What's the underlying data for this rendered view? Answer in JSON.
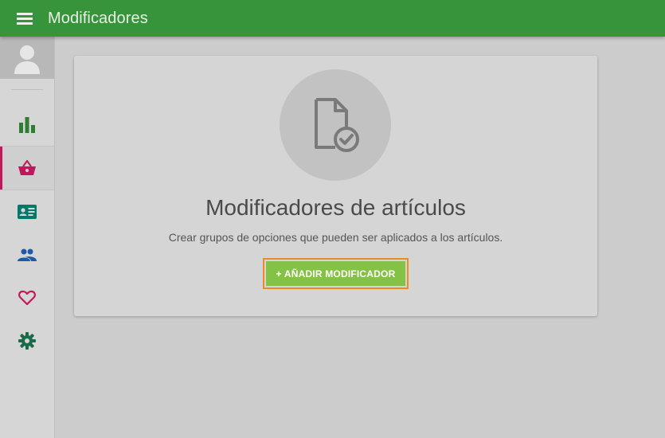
{
  "header": {
    "title": "Modificadores"
  },
  "sidebar": {
    "items": [
      {
        "name": "reports",
        "icon": "bar-chart-icon",
        "color": "#2e7d32",
        "active": false
      },
      {
        "name": "items",
        "icon": "basket-icon",
        "color": "#c2185b",
        "active": true
      },
      {
        "name": "employees",
        "icon": "id-card-icon",
        "color": "#00796b",
        "active": false
      },
      {
        "name": "customers",
        "icon": "people-icon",
        "color": "#1e5aa8",
        "active": false
      },
      {
        "name": "loyalty",
        "icon": "heart-icon",
        "color": "#c2185b",
        "active": false
      },
      {
        "name": "settings",
        "icon": "gear-icon",
        "color": "#1b6b4a",
        "active": false
      }
    ]
  },
  "card": {
    "icon": "document-check-icon",
    "title": "Modificadores de artículos",
    "subtitle": "Crear grupos de opciones que pueden ser aplicados a los artículos.",
    "button_label": "+ AÑADIR MODIFICADOR"
  },
  "colors": {
    "appbar": "#38943a",
    "accent_button": "#84c246",
    "focus_outline": "#f0891f",
    "active_indicator": "#c2185b"
  }
}
